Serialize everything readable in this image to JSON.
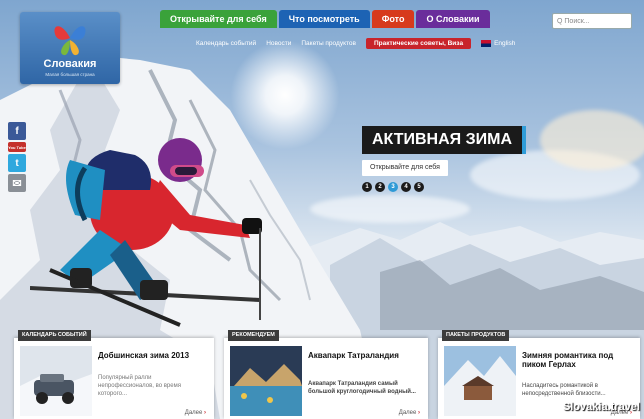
{
  "topnav": [
    {
      "label": "Открывайте для себя",
      "color": "#3aa23a"
    },
    {
      "label": "Что посмотреть",
      "color": "#1d63b4"
    },
    {
      "label": "Фото",
      "color": "#d73a1c"
    },
    {
      "label": "О Словакии",
      "color": "#6a2d9b"
    }
  ],
  "search": {
    "placeholder": "Q Поиск..."
  },
  "subnav": {
    "items": [
      "Календарь событий",
      "Новости",
      "Пакеты продуктов"
    ],
    "highlight": "Практические советы, Виза",
    "language": "English"
  },
  "logo": {
    "title": "Словакия",
    "subtitle": "Малая большая страна"
  },
  "social": [
    "f",
    "You Tube",
    "t",
    "✉"
  ],
  "hero": {
    "title": "АКТИВНАЯ ЗИМА",
    "cta": "Открывайте для себя",
    "slides": [
      "1",
      "2",
      "3",
      "4",
      "5"
    ],
    "active_slide": 3
  },
  "cards": [
    {
      "tag": "КАЛЕНДАРЬ СОБЫТИЙ",
      "title": "Добшинская зима 2013",
      "text": "Популярный ралли непрофессионалов, во время которого...",
      "more": "Далее"
    },
    {
      "tag": "РЕКОМЕНДУЕМ",
      "title": "Аквапарк Татраландия",
      "text": "Аквапарк Татраландия самый большой круглогодичный водный...",
      "more": "Далее"
    },
    {
      "tag": "ПАКЕТЫ ПРОДУКТОВ",
      "title": "Зимняя романтика под пиком Герлах",
      "text": "Насладитесь романтикой в непосредственной близости...",
      "more": "Далее"
    }
  ],
  "watermark": "Slovakia.travel",
  "colors": {
    "accent": "#2f9cd8",
    "brand_red": "#c8242b",
    "logo_bg": "#2f66a6"
  }
}
